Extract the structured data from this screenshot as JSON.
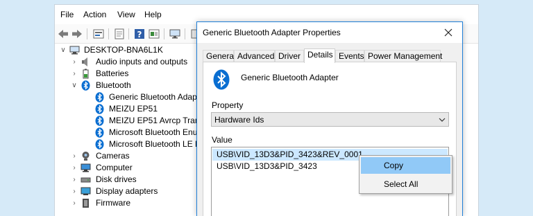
{
  "menubar": {
    "items": [
      "File",
      "Action",
      "View",
      "Help"
    ]
  },
  "tree": {
    "root": "DESKTOP-BNA6L1K",
    "items": [
      {
        "label": "Audio inputs and outputs",
        "icon": "speaker-icon"
      },
      {
        "label": "Batteries",
        "icon": "battery-icon"
      },
      {
        "label": "Bluetooth",
        "icon": "bluetooth-icon",
        "expanded": true
      },
      {
        "label": "Generic Bluetooth Adapte",
        "icon": "bluetooth-icon"
      },
      {
        "label": "MEIZU EP51",
        "icon": "bluetooth-icon"
      },
      {
        "label": "MEIZU EP51 Avrcp Transp",
        "icon": "bluetooth-icon"
      },
      {
        "label": "Microsoft Bluetooth Enur",
        "icon": "bluetooth-icon"
      },
      {
        "label": "Microsoft Bluetooth LE Er",
        "icon": "bluetooth-icon"
      },
      {
        "label": "Cameras",
        "icon": "camera-icon"
      },
      {
        "label": "Computer",
        "icon": "monitor-icon"
      },
      {
        "label": "Disk drives",
        "icon": "disk-icon"
      },
      {
        "label": "Display adapters",
        "icon": "display-icon"
      },
      {
        "label": "Firmware",
        "icon": "chip-icon"
      }
    ]
  },
  "dialog": {
    "title": "Generic Bluetooth Adapter Properties",
    "tabs": [
      "General",
      "Advanced",
      "Driver",
      "Details",
      "Events",
      "Power Management"
    ],
    "active_tab": "Details",
    "device_name": "Generic Bluetooth Adapter",
    "property_label": "Property",
    "property_value": "Hardware Ids",
    "value_label": "Value",
    "values": [
      "USB\\VID_13D3&PID_3423&REV_0001",
      "USB\\VID_13D3&PID_3423"
    ]
  },
  "context_menu": {
    "items": [
      "Copy",
      "Select All"
    ],
    "highlighted": "Copy"
  },
  "colors": {
    "accent": "#1f7fd8",
    "bluetooth": "#0a6ed1",
    "selection": "#cce8ff",
    "menu_highlight": "#91c9f7",
    "background": "#d6eaf8"
  }
}
